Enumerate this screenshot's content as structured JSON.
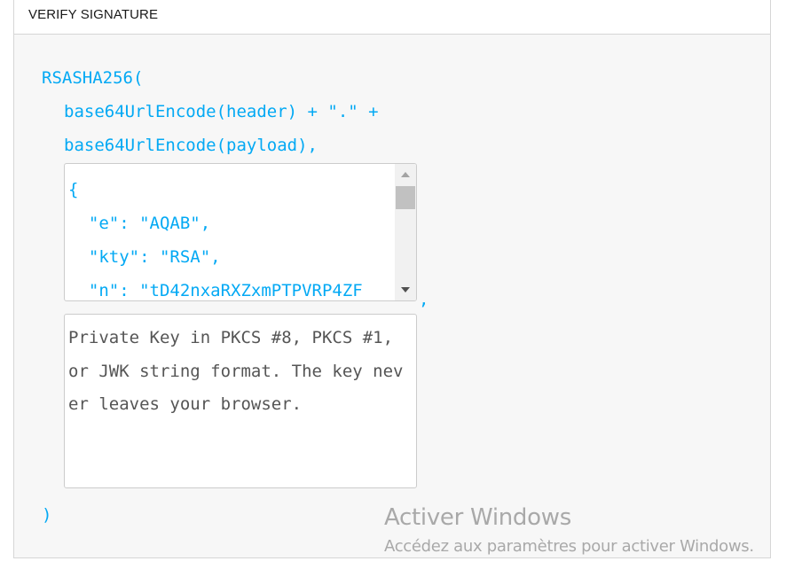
{
  "section": {
    "title": "VERIFY SIGNATURE"
  },
  "code": {
    "func_open": "RSASHA256(",
    "arg1": "base64UrlEncode(header) + \".\" +",
    "arg2": "base64UrlEncode(payload),",
    "comma": ",",
    "func_close": ")"
  },
  "public_key": {
    "lines": [
      "{",
      "  \"e\": \"AQAB\",",
      "  \"kty\": \"RSA\",",
      "  \"n\": \"tD42nxaRXZxmPTPVRP4ZF"
    ]
  },
  "private_key": {
    "placeholder": "Private Key in PKCS #8, PKCS #1, or JWK string format. The key never leaves your browser."
  },
  "watermark": {
    "title": "Activer Windows",
    "subtitle": "Accédez aux paramètres pour activer Windows."
  },
  "colors": {
    "code": "#03a9f4",
    "placeholder": "#555555",
    "watermark": "#a9a9a9"
  },
  "icons": {
    "scroll_up": "scroll-up-arrow-icon",
    "scroll_down": "scroll-down-arrow-icon"
  }
}
